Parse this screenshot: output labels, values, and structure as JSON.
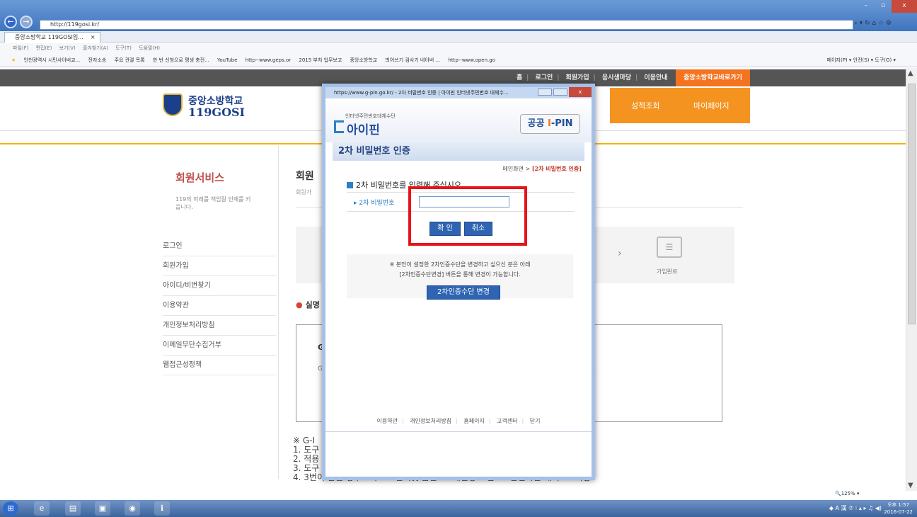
{
  "browser": {
    "address": "http://119gosi.kr/",
    "tab_title": "중앙소방학교 119GOSI입...",
    "tab_close": "×",
    "menu_items": [
      "파일(F)",
      "편집(E)",
      "보기(V)",
      "즐겨찾기(A)",
      "도구(T)",
      "도움말(H)"
    ],
    "favorites": [
      "인천광역시 시민사이버교...",
      "전자소송",
      "주요 관결 목록",
      "한 번 신청으로 평생 충전...",
      "YouTube",
      "http--www.geps.or",
      "2015 부처 업무보고",
      "중앙소방학교",
      "띄어쓰기 검사기 네이버 ...",
      "http--www.open.go"
    ],
    "command_items": [
      "페이지(P) ▾",
      "안전(S) ▾",
      "도구(O) ▾"
    ],
    "zoom": "🔍125% ▾"
  },
  "site": {
    "top_links": [
      "홈",
      "로그인",
      "회원가입",
      "응시생마당",
      "이용안내"
    ],
    "shortcut": "중앙소방학교바로가기",
    "logo_line1": "중앙소방학교",
    "logo_line2": "119GOSI",
    "orange_menu": [
      "성적조회",
      "마이페이지"
    ],
    "sidebar_title": "회원서비스",
    "sidebar_desc": "119의 미래를 책임질 인재를 키웁니다.",
    "sidebar_items": [
      "로그인",
      "회원가입",
      "아이디/비번찾기",
      "이용약관",
      "개인정보처리방침",
      "이메일무단수집거부",
      "웹접근성정책"
    ],
    "main_title": "회원",
    "main_sub": "회원가",
    "step_label": "가입완료",
    "section_heading": "실명",
    "box_line1": "G",
    "box_line2": "G",
    "notes": [
      "※ G-I",
      "1. 도구 ->                                              -> 팝업차단 설정 -> 팝업 표시 -> 사용체크 -> 확인 -> 적용",
      "2. 적용 ->                                              에 추가 -> 팝업차단 해제를 해주세요.",
      "3. 도구 -> 팝업차단 -> 팝업차단끄기 -> G-PIN인증 -> 회원가입",
      "4. 3번이 안될 경우 도구 -> 인터넷 옵션 -> 개인정보 탭 -> 팝업차단 해지 -> 적용"
    ]
  },
  "popup": {
    "window_title": "https://www.g-pin.go.kr/ - 2차 비밀번호 인증 | 아이핀 인터넷주민번호 대체수...",
    "close": "x",
    "brand_small": "인터넷주민번호대체수단",
    "brand": "아이핀",
    "badge_prefix": "공공 ",
    "badge_i": "I",
    "badge_suffix": "-PIN",
    "heading": "2차 비밀번호 인증",
    "breadcrumb_prefix": "메인화면 > ",
    "breadcrumb_current": "[2차 비밀번호 인증]",
    "instruction": "2차 비밀번호를 입력해 주십시오",
    "field_label": "▸ 2차 비밀번호",
    "field_value": "",
    "confirm_button": "확 인",
    "cancel_button": "취소",
    "note_line1": "※ 본인이 설정한 2차인증수단을 변경하고 싶으신 분은 아래",
    "note_line2": "[2차인증수단변경] 버튼을 통해 변경이 가능합니다.",
    "change_button": "2차인증수단 변경",
    "footer_links": [
      "이용약관",
      "개인정보처리방침",
      "홈페이지",
      "고객센터",
      "닫기"
    ]
  },
  "taskbar": {
    "tray_text": "◆ A 漢 ⑦ ⁝ ▴ ▸ ♫ ◀)",
    "time": "오후 1:57",
    "date": "2016-07-22"
  },
  "colors": {
    "accent_orange": "#f4931f",
    "highlight_red": "#e8131a",
    "ipin_blue": "#2e64b2"
  }
}
